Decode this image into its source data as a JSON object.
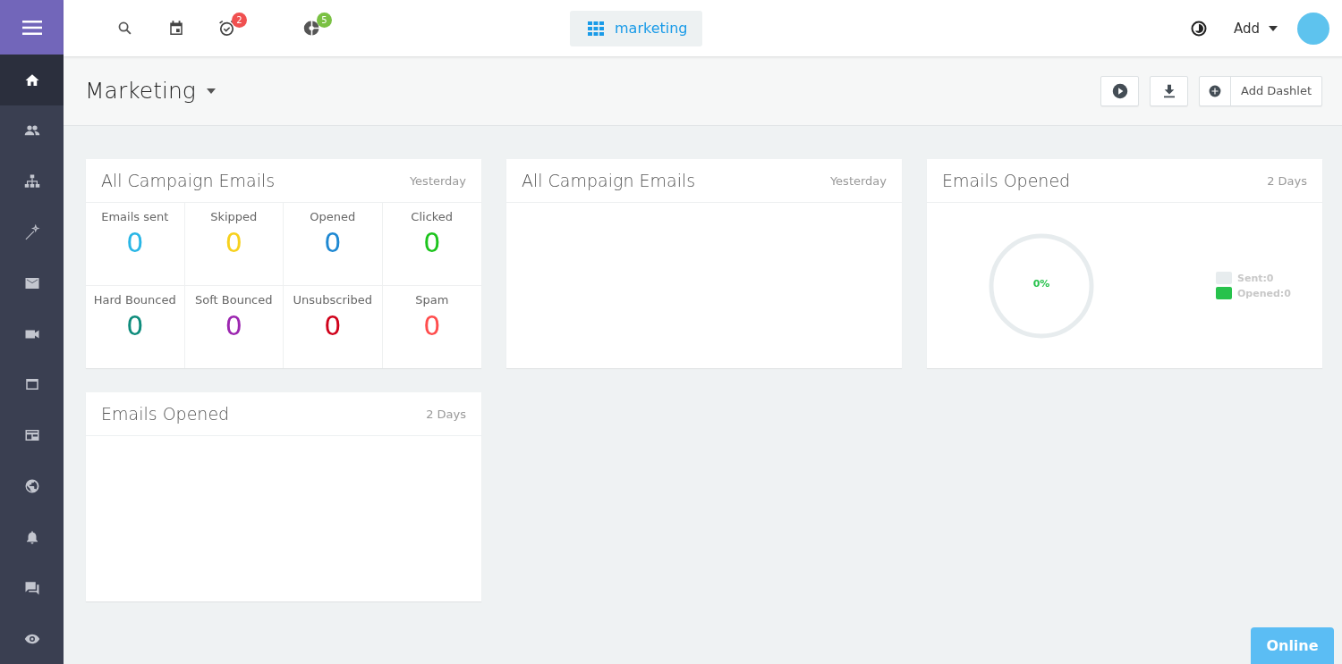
{
  "topbar": {
    "alarm_badge": "2",
    "reports_badge": "5",
    "workspace": "marketing",
    "add_menu": "Add"
  },
  "sidebar": {
    "items": [
      {
        "selected": true
      },
      {
        "selected": false
      },
      {
        "selected": false
      },
      {
        "selected": false
      },
      {
        "selected": false
      },
      {
        "selected": false
      },
      {
        "selected": false
      },
      {
        "selected": false
      },
      {
        "selected": false
      },
      {
        "selected": false
      },
      {
        "selected": false
      },
      {
        "selected": false
      }
    ]
  },
  "header": {
    "title": "Marketing",
    "add_dashlet": "Add Dashlet"
  },
  "dashlets": [
    {
      "kind": "stats",
      "title": "All Campaign Emails",
      "period": "Yesterday",
      "stats": [
        {
          "label": "Emails sent",
          "value": "0",
          "color": "#29b6e6"
        },
        {
          "label": "Skipped",
          "value": "0",
          "color": "#f7d11e"
        },
        {
          "label": "Opened",
          "value": "0",
          "color": "#1e88d2"
        },
        {
          "label": "Clicked",
          "value": "0",
          "color": "#1dc41d"
        },
        {
          "label": "Hard Bounced",
          "value": "0",
          "color": "#0e8c7c"
        },
        {
          "label": "Soft Bounced",
          "value": "0",
          "color": "#9c27b0"
        },
        {
          "label": "Unsubscribed",
          "value": "0",
          "color": "#d0021b"
        },
        {
          "label": "Spam",
          "value": "0",
          "color": "#ff4d4d"
        }
      ]
    },
    {
      "kind": "empty",
      "title": "All Campaign Emails",
      "period": "Yesterday"
    },
    {
      "kind": "gauge",
      "title": "Emails Opened",
      "period": "2 Days",
      "gauge": {
        "reading": "0%"
      },
      "legend": [
        {
          "label": "Sent:0",
          "color": "#e7ecee"
        },
        {
          "label": "Opened:0",
          "color": "#27c24c"
        }
      ]
    },
    {
      "kind": "empty",
      "title": "Emails Opened",
      "period": "2 Days"
    }
  ],
  "status_button": "Online"
}
